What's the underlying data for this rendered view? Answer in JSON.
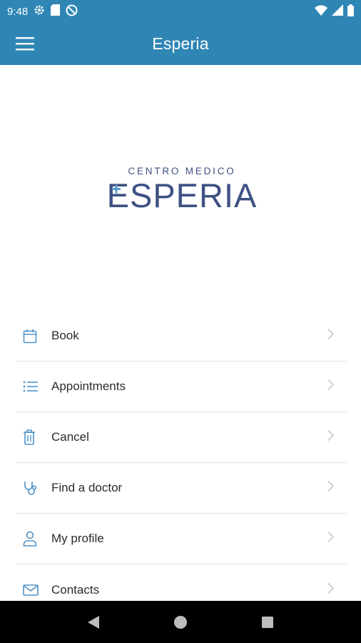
{
  "status_bar": {
    "time": "9:48",
    "left_icons": [
      "settings-icon",
      "sd-card-icon",
      "no-data-icon"
    ],
    "right_icons": [
      "wifi-icon",
      "signal-icon",
      "battery-icon"
    ]
  },
  "app_bar": {
    "title": "Esperia",
    "menu_icon": "hamburger-menu-icon"
  },
  "logo": {
    "line1": "CENTRO MEDICO",
    "line2": "ESPERIA",
    "color": "#3e5183",
    "cross_color": "#5a9bd1"
  },
  "menu": {
    "items": [
      {
        "label": "Book",
        "icon": "calendar-icon"
      },
      {
        "label": "Appointments",
        "icon": "list-icon"
      },
      {
        "label": "Cancel",
        "icon": "trash-icon"
      },
      {
        "label": "Find a doctor",
        "icon": "stethoscope-icon"
      },
      {
        "label": "My profile",
        "icon": "person-icon"
      },
      {
        "label": "Contacts",
        "icon": "mail-icon"
      }
    ]
  },
  "colors": {
    "primary": "#2f86b5",
    "icon_accent": "#4f93c9",
    "chevron": "#c9c9c9"
  },
  "nav_bar": {
    "buttons": [
      "back-icon",
      "home-icon",
      "recents-icon"
    ]
  }
}
